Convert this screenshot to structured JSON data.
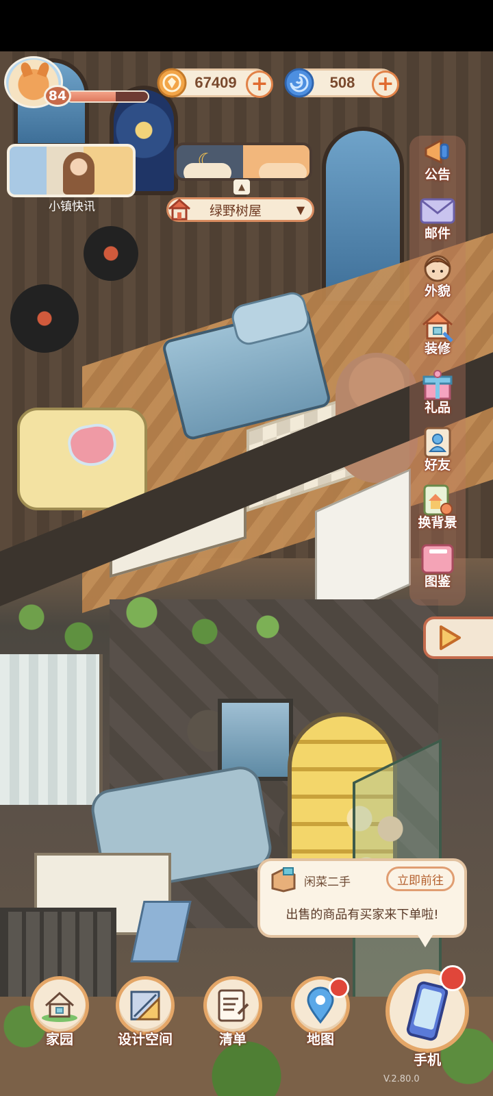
{
  "player": {
    "level": "84",
    "xp_fraction": 0.6
  },
  "currencies": [
    {
      "name": "coin",
      "icon": "coin-icon",
      "value": "67409",
      "plus": "+"
    },
    {
      "name": "gem",
      "icon": "swirl-gem-icon",
      "value": "508",
      "plus": "+"
    }
  ],
  "news": {
    "label": "小镇快讯"
  },
  "daynight": {
    "arrow": "▲"
  },
  "location": {
    "name": "绿野树屋",
    "dropdown": "▼"
  },
  "sidebar": {
    "items": [
      {
        "label": "公告",
        "icon": "megaphone-icon"
      },
      {
        "label": "邮件",
        "icon": "mail-icon"
      },
      {
        "label": "外貌",
        "icon": "character-face-icon"
      },
      {
        "label": "装修",
        "icon": "house-wrench-icon"
      },
      {
        "label": "礼品",
        "icon": "gift-box-icon"
      },
      {
        "label": "好友",
        "icon": "friend-card-icon"
      },
      {
        "label": "换背景",
        "icon": "background-card-icon"
      },
      {
        "label": "图鉴",
        "icon": "album-book-icon"
      }
    ],
    "expand": "▶"
  },
  "notification": {
    "title": "闲菜二手",
    "button": "立即前往",
    "message": "出售的商品有买家来下单啦!"
  },
  "bottom_nav": {
    "items": [
      {
        "label": "家园",
        "icon": "home-icon",
        "badge": false
      },
      {
        "label": "设计空间",
        "icon": "design-ruler-icon",
        "badge": false
      },
      {
        "label": "清单",
        "icon": "checklist-icon",
        "badge": false
      },
      {
        "label": "地图",
        "icon": "map-pin-icon",
        "badge": true
      }
    ],
    "phone": {
      "label": "手机",
      "icon": "phone-icon",
      "badge": true
    }
  },
  "footer": {
    "version": "V.2.80.0"
  },
  "colors": {
    "accent_orange": "#e4a667",
    "badge_red": "#e0463a",
    "cream": "#f6e8d3"
  }
}
